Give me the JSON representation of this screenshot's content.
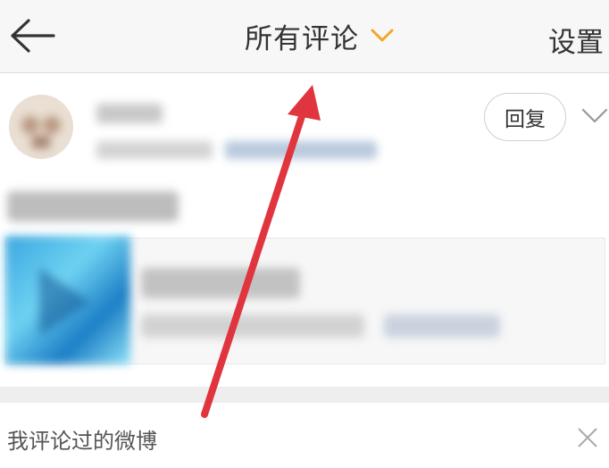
{
  "navbar": {
    "back_icon": "back-arrow-icon",
    "title": "所有评论",
    "dropdown_icon": "chevron-down-icon",
    "accent_color": "#f5a623",
    "settings_label": "设置"
  },
  "comment": {
    "reply_label": "回复",
    "more_icon": "chevron-down-icon"
  },
  "bottom_bar": {
    "label": "我评论过的微博",
    "close_icon": "close-icon"
  },
  "annotation": {
    "arrow_color": "#e0343f"
  }
}
